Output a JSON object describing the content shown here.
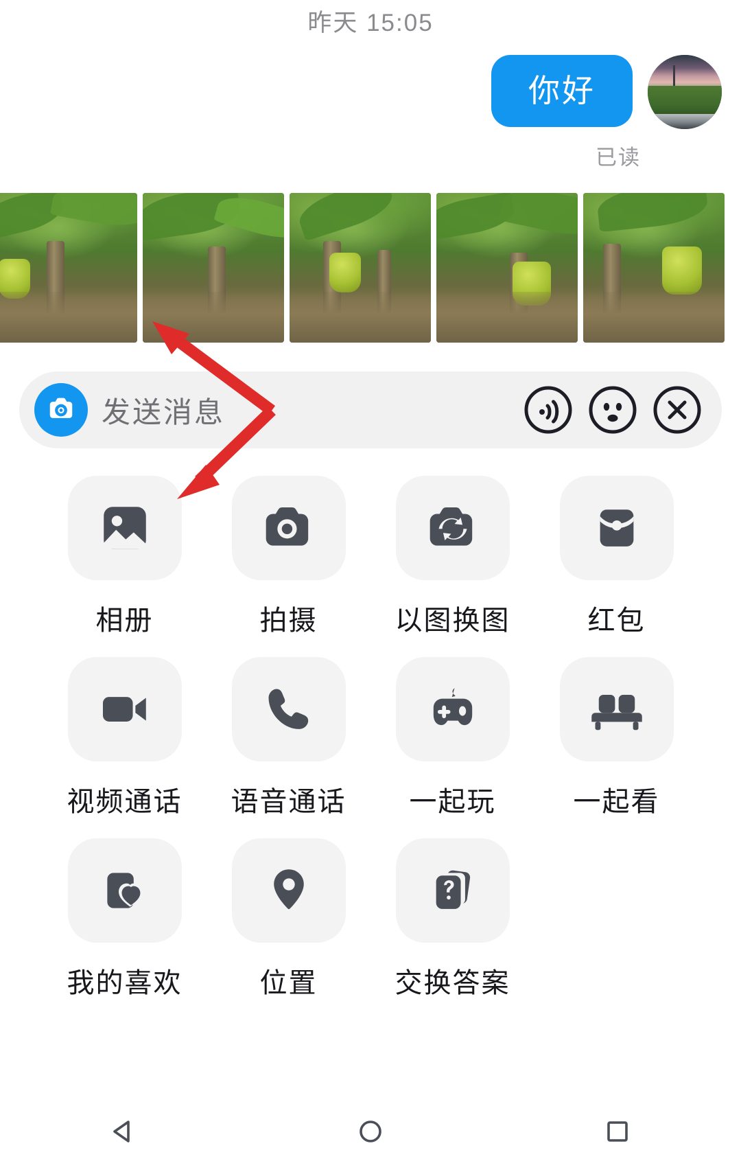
{
  "conversation": {
    "timestamp": "昨天 15:05",
    "messages": [
      {
        "text": "你好",
        "side": "outgoing",
        "status": "已读",
        "bubble_color": "#1296f0",
        "text_color": "#ffffff"
      }
    ],
    "avatar": {
      "name": "user-avatar",
      "description": "sunset-field-road-photo"
    }
  },
  "photo_strip": {
    "name": "banana-plantation-photos",
    "count": 5,
    "items": [
      {
        "alt": "banana-plantation-1"
      },
      {
        "alt": "banana-plantation-2"
      },
      {
        "alt": "banana-plantation-3"
      },
      {
        "alt": "banana-plantation-4"
      },
      {
        "alt": "banana-plantation-5"
      }
    ]
  },
  "input_bar": {
    "camera_icon": "aperture-icon",
    "placeholder": "发送消息",
    "value": "",
    "accent_color": "#1296f0",
    "background": "#f1f1f2",
    "actions": [
      {
        "icon": "voice-wave-icon",
        "label": "语音"
      },
      {
        "icon": "emoji-face-icon",
        "label": "表情"
      },
      {
        "icon": "close-icon",
        "label": "关闭"
      }
    ]
  },
  "app_panel": {
    "tile_background": "#f3f3f4",
    "icon_color": "#4a4f57",
    "items": [
      {
        "label": "相册",
        "icon": "photo-album-icon"
      },
      {
        "label": "拍摄",
        "icon": "camera-icon"
      },
      {
        "label": "以图换图",
        "icon": "image-swap-icon"
      },
      {
        "label": "红包",
        "icon": "red-packet-icon"
      },
      {
        "label": "视频通话",
        "icon": "video-call-icon"
      },
      {
        "label": "语音通话",
        "icon": "phone-call-icon"
      },
      {
        "label": "一起玩",
        "icon": "gamepad-icon"
      },
      {
        "label": "一起看",
        "icon": "sofa-icon"
      },
      {
        "label": "我的喜欢",
        "icon": "favorite-heart-icon"
      },
      {
        "label": "位置",
        "icon": "location-pin-icon"
      },
      {
        "label": "交换答案",
        "icon": "question-cards-icon"
      }
    ]
  },
  "annotations": {
    "color": "#e02b2b",
    "arrows": [
      {
        "name": "arrow-to-photo-strip",
        "points_to": "photo-strip"
      },
      {
        "name": "arrow-to-album-tile",
        "points_to": "album-tile"
      }
    ]
  },
  "system_nav": {
    "buttons": [
      {
        "name": "back-button",
        "icon": "triangle-back-icon"
      },
      {
        "name": "home-button",
        "icon": "circle-home-icon"
      },
      {
        "name": "recents-button",
        "icon": "square-recents-icon"
      }
    ]
  }
}
